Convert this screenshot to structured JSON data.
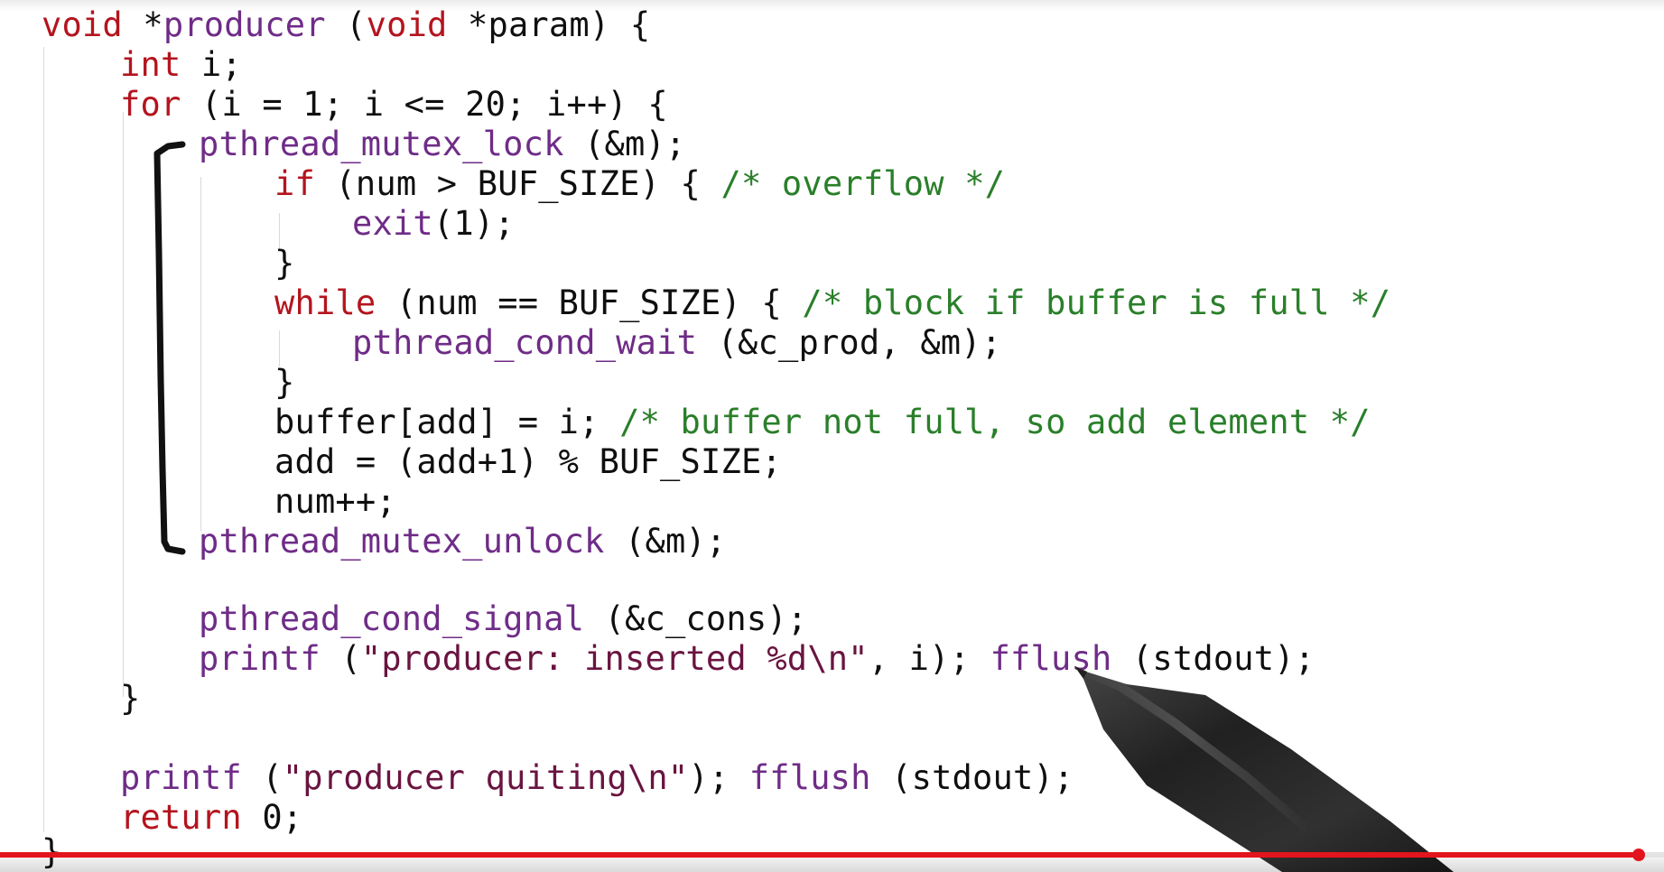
{
  "code": {
    "lines": [
      [
        {
          "t": "kw",
          "v": "void"
        },
        {
          "t": "plain",
          "v": " *"
        },
        {
          "t": "fn",
          "v": "producer"
        },
        {
          "t": "plain",
          "v": " ("
        },
        {
          "t": "kw",
          "v": "void"
        },
        {
          "t": "plain",
          "v": " *param) {"
        }
      ],
      [
        {
          "t": "kw",
          "v": "int"
        },
        {
          "t": "plain",
          "v": " i;"
        }
      ],
      [
        {
          "t": "kw",
          "v": "for"
        },
        {
          "t": "plain",
          "v": " (i = 1; i <= 20; i++) {"
        }
      ],
      [
        {
          "t": "fn",
          "v": "pthread_mutex_lock"
        },
        {
          "t": "plain",
          "v": " (&m);"
        }
      ],
      [
        {
          "t": "kw",
          "v": "if"
        },
        {
          "t": "plain",
          "v": " (num > BUF_SIZE) { "
        },
        {
          "t": "cm",
          "v": "/* overflow */"
        }
      ],
      [
        {
          "t": "fn",
          "v": "exit"
        },
        {
          "t": "plain",
          "v": "(1);"
        }
      ],
      [
        {
          "t": "plain",
          "v": "}"
        }
      ],
      [
        {
          "t": "kw",
          "v": "while"
        },
        {
          "t": "plain",
          "v": " (num == BUF_SIZE) { "
        },
        {
          "t": "cm",
          "v": "/* block if buffer is full */"
        }
      ],
      [
        {
          "t": "fn",
          "v": "pthread_cond_wait"
        },
        {
          "t": "plain",
          "v": " (&c_prod, &m);"
        }
      ],
      [
        {
          "t": "plain",
          "v": "}"
        }
      ],
      [
        {
          "t": "plain",
          "v": "buffer[add] = i; "
        },
        {
          "t": "cm",
          "v": "/* buffer not full, so add element */"
        }
      ],
      [
        {
          "t": "plain",
          "v": "add = (add+1) % BUF_SIZE;"
        }
      ],
      [
        {
          "t": "plain",
          "v": "num++;"
        }
      ],
      [
        {
          "t": "fn",
          "v": "pthread_mutex_unlock"
        },
        {
          "t": "plain",
          "v": " (&m);"
        }
      ],
      [
        {
          "t": "fn",
          "v": "pthread_cond_signal"
        },
        {
          "t": "plain",
          "v": " (&c_cons);"
        }
      ],
      [
        {
          "t": "fn",
          "v": "printf"
        },
        {
          "t": "plain",
          "v": " ("
        },
        {
          "t": "str",
          "v": "\"producer: inserted %d\\n\""
        },
        {
          "t": "plain",
          "v": ", i); "
        },
        {
          "t": "fn",
          "v": "fflush"
        },
        {
          "t": "plain",
          "v": " (stdout);"
        }
      ],
      [
        {
          "t": "plain",
          "v": "}"
        }
      ],
      [
        {
          "t": "fn",
          "v": "printf"
        },
        {
          "t": "plain",
          "v": " ("
        },
        {
          "t": "str",
          "v": "\"producer quiting\\n\""
        },
        {
          "t": "plain",
          "v": "); "
        },
        {
          "t": "fn",
          "v": "fflush"
        },
        {
          "t": "plain",
          "v": " (stdout);"
        }
      ],
      [
        {
          "t": "kw",
          "v": "return"
        },
        {
          "t": "plain",
          "v": " 0;"
        }
      ],
      [
        {
          "t": "plain",
          "v": "}"
        }
      ]
    ]
  },
  "video": {
    "progress_fraction": 0.985
  },
  "icons": {
    "annotation": "hand-drawn-bracket",
    "pointer": "pen-pointer-icon"
  },
  "colors": {
    "keyword": "#b4141e",
    "function": "#6f2c87",
    "comment": "#2a7f2a",
    "string": "#6a1440",
    "progress": "#e3141d"
  }
}
